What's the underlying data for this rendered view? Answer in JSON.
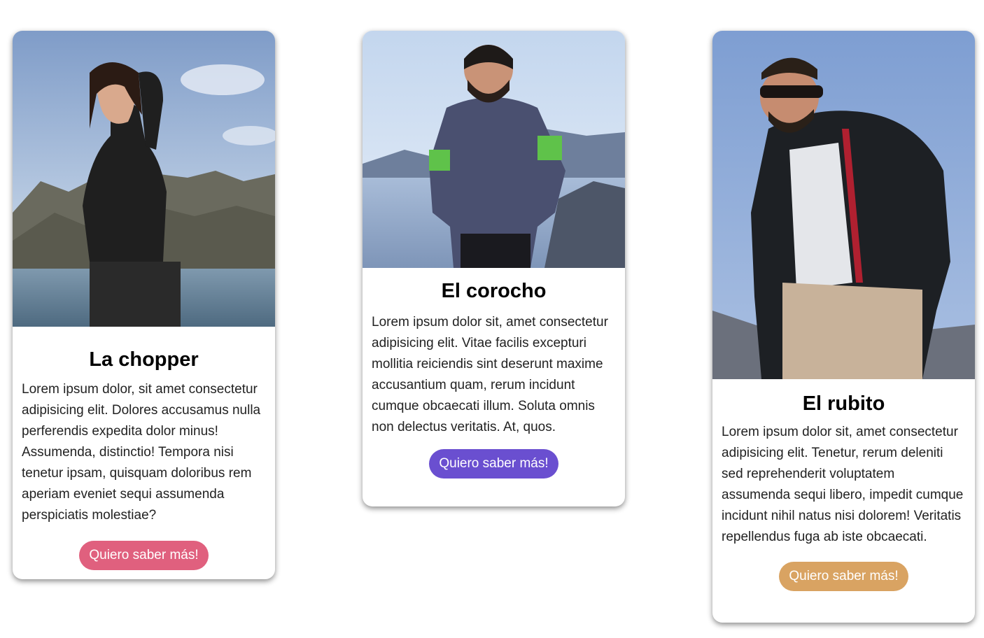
{
  "cards": [
    {
      "title": "La chopper",
      "text": "Lorem ipsum dolor, sit amet consectetur adipisicing elit. Dolores accusamus nulla perferendis expedita dolor minus! Assumenda, distinctio! Tempora nisi tenetur ipsam, quisquam doloribus rem aperiam eveniet sequi assumenda perspiciatis molestiae?",
      "button_label": "Quiero saber más!",
      "button_color": "#e0607e"
    },
    {
      "title": "El corocho",
      "text": "Lorem ipsum dolor sit, amet consectetur adipisicing elit. Vitae facilis excepturi mollitia reiciendis sint deserunt maxime accusantium quam, rerum incidunt cumque obcaecati illum. Soluta omnis non delectus veritatis. At, quos.",
      "button_label": "Quiero saber más!",
      "button_color": "#6a4fd0"
    },
    {
      "title": "El rubito",
      "text": "Lorem ipsum dolor sit, amet consectetur adipisicing elit. Tenetur, rerum deleniti sed reprehenderit voluptatem assumenda sequi libero, impedit cumque incidunt nihil natus nisi dolorem! Veritatis repellendus fuga ab iste obcaecati.",
      "button_label": "Quiero saber más!",
      "button_color": "#d9a362"
    }
  ]
}
